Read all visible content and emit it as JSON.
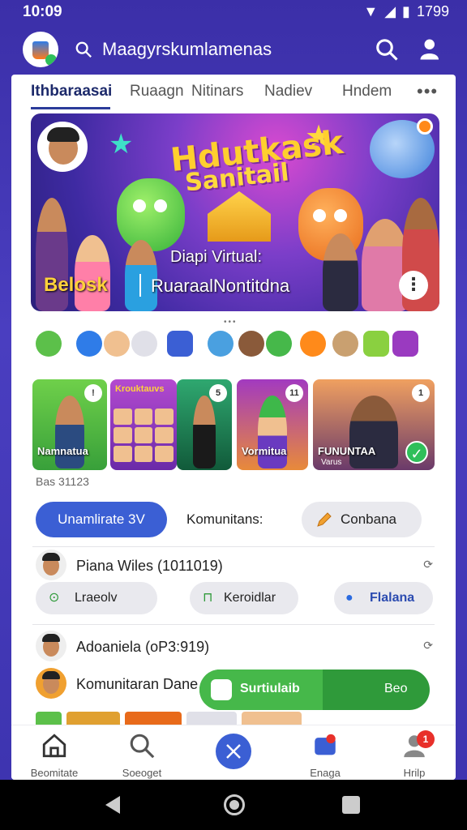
{
  "status_bar": {
    "time": "10:09",
    "battery_text": "1799"
  },
  "header": {
    "title": "Maagyrskumlamenas"
  },
  "tabs": [
    {
      "label": "Ithbaraasai",
      "active": true
    },
    {
      "label": "Ruaagn"
    },
    {
      "label": "Nitinars"
    },
    {
      "label": "Nadiev"
    },
    {
      "label": "Hndem"
    }
  ],
  "hero": {
    "title_line1": "Hdutkask",
    "title_line2": "Sanitail",
    "caption": "Diapi Virtual:",
    "left_label": "Belosk",
    "right_label": "RuaraalNontitdna"
  },
  "cards": [
    {
      "label": "Namnatua",
      "badge": "!"
    },
    {
      "label": "",
      "top_text": "Krouktauvs"
    },
    {
      "label": "",
      "badge": "5"
    },
    {
      "label": "Vormitua",
      "badge": "11"
    },
    {
      "label": "FUNUNTAA",
      "sub": "Varus",
      "badge": "1"
    }
  ],
  "count_label": "Bas 31123",
  "actions": {
    "primary": "Unamlirate 3V",
    "label": "Komunitans:",
    "secondary": "Conbana"
  },
  "list": [
    {
      "title": "Piana Wiles (1011019)"
    },
    {
      "title": "Adoaniela (oP3:919)"
    },
    {
      "title": "Komunitaran Dane"
    }
  ],
  "chips": [
    {
      "label": "Lraeolv"
    },
    {
      "label": "Keroidlar"
    },
    {
      "label": "Flalana"
    }
  ],
  "toast": {
    "text": "Surtiulaib",
    "action": "Beo"
  },
  "bottom_nav": [
    {
      "label": "Beomitate"
    },
    {
      "label": "Soeoget"
    },
    {
      "label": ""
    },
    {
      "label": "Enaga"
    },
    {
      "label": "Hrilp",
      "badge": "1"
    }
  ],
  "colors": {
    "header_bg": "#3b2fa8",
    "primary_button": "#3b5fd4",
    "toast_green": "#2f9a3a",
    "badge_red": "#e8302a"
  }
}
